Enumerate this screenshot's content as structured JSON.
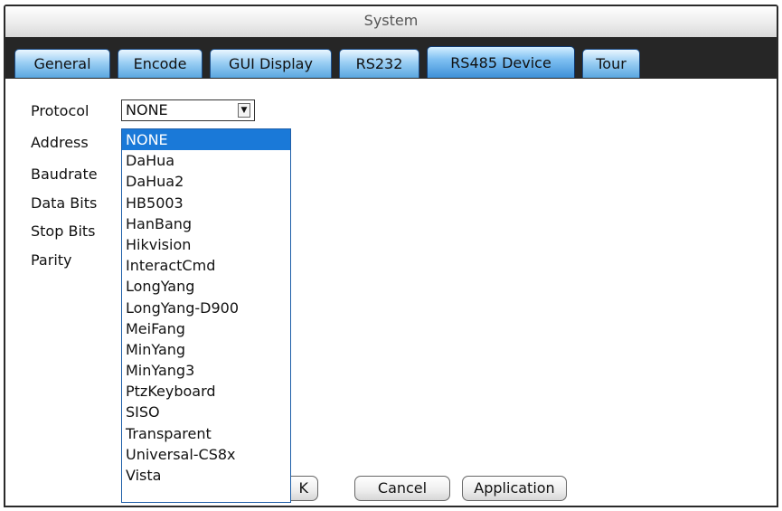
{
  "window": {
    "title": "System"
  },
  "tabs": [
    {
      "label": "General"
    },
    {
      "label": "Encode"
    },
    {
      "label": "GUI Display"
    },
    {
      "label": "RS232"
    },
    {
      "label": "RS485 Device",
      "active": true
    },
    {
      "label": "Tour"
    }
  ],
  "form": {
    "protocol_label": "Protocol",
    "address_label": "Address",
    "baudrate_label": "Baudrate",
    "databits_label": "Data Bits",
    "stopbits_label": "Stop Bits",
    "parity_label": "Parity",
    "protocol_value": "NONE"
  },
  "dropdown": {
    "selected": "NONE",
    "options": [
      "NONE",
      "DaHua",
      "DaHua2",
      "HB5003",
      "HanBang",
      "Hikvision",
      "InteractCmd",
      "LongYang",
      "LongYang-D900",
      "MeiFang",
      "MinYang",
      "MinYang3",
      "PtzKeyboard",
      "SISO",
      "Transparent",
      "Universal-CS8x",
      "Vista"
    ]
  },
  "buttons": {
    "ok_label_visible": "K",
    "cancel_label": "Cancel",
    "application_label": "Application"
  },
  "colors": {
    "tab_blue": "#5aa7e0",
    "selection": "#1a79d8",
    "tabbar_bg": "#262626"
  }
}
